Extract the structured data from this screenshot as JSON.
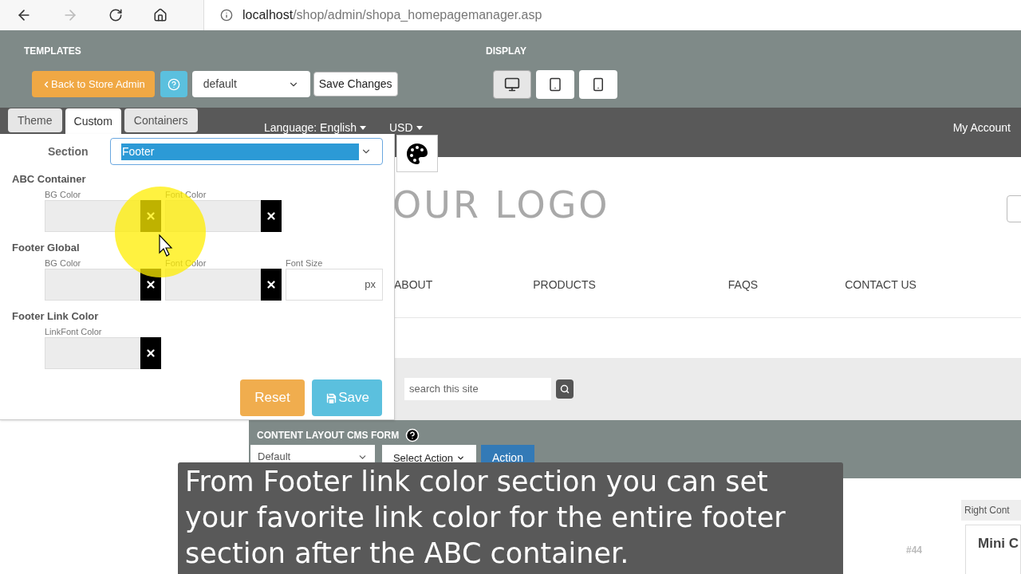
{
  "browser": {
    "url_host": "localhost",
    "url_path": "/shop/admin/shopa_homepagemanager.asp"
  },
  "admin_bar": {
    "templates_title": "TEMPLATES",
    "back_button": "Back to Store Admin",
    "template_select": "default",
    "save_button": "Save Changes",
    "display_title": "DISPLAY",
    "display_modes": [
      {
        "kind": "desktop",
        "selected": true
      },
      {
        "kind": "tablet",
        "selected": false
      },
      {
        "kind": "phone",
        "selected": false
      }
    ]
  },
  "site_top_bar": {
    "language": "Language: English",
    "currency": "USD",
    "account": "My Account"
  },
  "panel": {
    "tabs": [
      {
        "label": "Theme",
        "selected": false
      },
      {
        "label": "Custom",
        "selected": true
      },
      {
        "label": "Containers",
        "selected": false
      }
    ],
    "section_label": "Section",
    "section_value": "Footer",
    "groups": [
      {
        "title": "ABC Container",
        "fields": [
          {
            "kind": "color",
            "label": "BG Color"
          },
          {
            "kind": "color",
            "label": "Font Color"
          }
        ]
      },
      {
        "title": "Footer Global",
        "fields": [
          {
            "kind": "color",
            "label": "BG Color"
          },
          {
            "kind": "color",
            "label": "Font Color"
          },
          {
            "kind": "size",
            "label": "Font Size",
            "unit": "px"
          }
        ]
      },
      {
        "title": "Footer Link Color",
        "fields": [
          {
            "kind": "color",
            "label": "LinkFont Color"
          }
        ]
      }
    ],
    "reset_button": "Reset",
    "save_button": "Save"
  },
  "site": {
    "logo": "OUR LOGO",
    "nav": [
      "ABOUT",
      "PRODUCTS",
      "FAQS",
      "CONTACT US"
    ],
    "search_placeholder": "search this site"
  },
  "cms_form": {
    "title": "CONTENT LAYOUT CMS FORM",
    "layout_select": "Default",
    "action_select": "Select Action",
    "action_button": "Action"
  },
  "right_container": {
    "tab": "Right Cont",
    "card_title": "Mini C",
    "number": "#44"
  },
  "caption": "From Footer link color section you can set your favorite link color for the entire footer section after the ABC container."
}
